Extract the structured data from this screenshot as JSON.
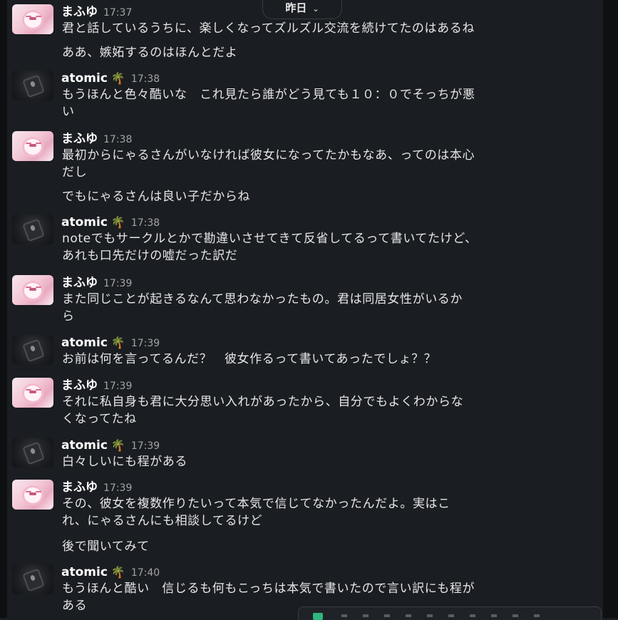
{
  "date_divider": {
    "label": "昨日",
    "icon": "chevron-down-icon"
  },
  "users": {
    "mafuyu": {
      "name": "まふゆ"
    },
    "atomic": {
      "name": "atomic",
      "status_emoji": "🌴"
    }
  },
  "messages": [
    {
      "user": "まふゆ",
      "time": "17:37",
      "lines": [
        "君と話しているうちに、楽しくなってズルズル交流を続けてたのはあるね"
      ],
      "followup": "ああ、嫉妬するのはほんとだよ"
    },
    {
      "user": "atomic",
      "time": "17:38",
      "lines": [
        "もうほんと色々酷いな　これ見たら誰がどう見ても１０：０でそっちが悪",
        "い"
      ]
    },
    {
      "user": "まふゆ",
      "time": "17:38",
      "lines": [
        "最初からにゃるさんがいなければ彼女になってたかもなあ、ってのは本心",
        "だし"
      ],
      "followup": "でもにゃるさんは良い子だからね"
    },
    {
      "user": "atomic",
      "time": "17:38",
      "lines": [
        "noteでもサークルとかで勘違いさせてきて反省してるって書いてたけど、",
        "あれも口先だけの嘘だった訳だ"
      ]
    },
    {
      "user": "まふゆ",
      "time": "17:39",
      "lines": [
        "また同じことが起きるなんて思わなかったもの。君は同居女性がいるか",
        "ら"
      ]
    },
    {
      "user": "atomic",
      "time": "17:39",
      "lines": [
        "お前は何を言ってるんだ？　彼女作るって書いてあったでしょ？？"
      ]
    },
    {
      "user": "まふゆ",
      "time": "17:39",
      "lines": [
        "それに私自身も君に大分思い入れがあったから、自分でもよくわからな",
        "くなってたね"
      ]
    },
    {
      "user": "atomic",
      "time": "17:39",
      "lines": [
        "白々しいにも程がある"
      ]
    },
    {
      "user": "まふゆ",
      "time": "17:39",
      "lines": [
        "その、彼女を複数作りたいって本気で信じてなかったんだよ。実はこ",
        "れ、にゃるさんにも相談してるけど"
      ],
      "followup": "後で聞いてみて"
    },
    {
      "user": "atomic",
      "time": "17:40",
      "lines": [
        "もうほんと酷い　信じるも何もこっちは本気で書いたので言い訳にも程が",
        "ある"
      ]
    }
  ]
}
